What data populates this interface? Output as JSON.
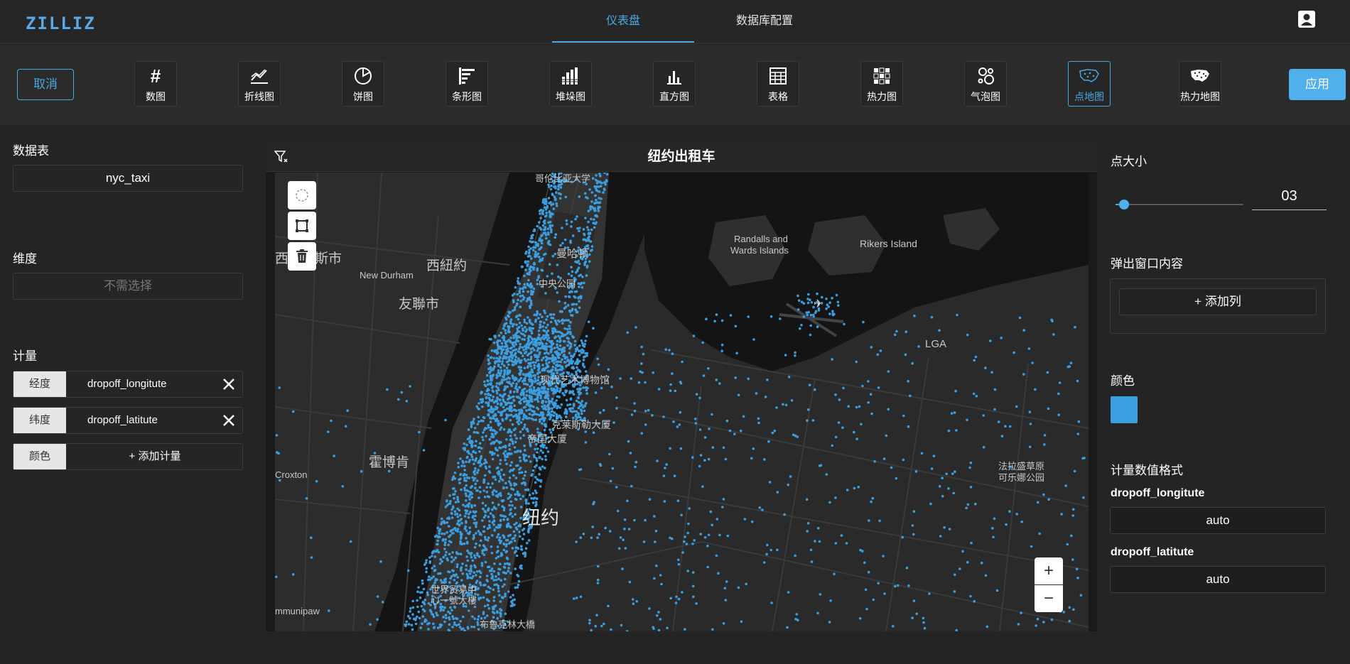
{
  "nav": {
    "logo": "ZILLIZ",
    "tabs": [
      {
        "label": "仪表盘",
        "active": true
      },
      {
        "label": "数据库配置",
        "active": false
      }
    ],
    "account_icon": "account-icon"
  },
  "toolbar": {
    "cancel_label": "取消",
    "apply_label": "应用",
    "chart_types": [
      {
        "label": "数图",
        "icon": "number-icon"
      },
      {
        "label": "折线图",
        "icon": "line-chart-icon"
      },
      {
        "label": "饼图",
        "icon": "pie-chart-icon"
      },
      {
        "label": "条形图",
        "icon": "bar-chart-icon"
      },
      {
        "label": "堆垛图",
        "icon": "stacked-chart-icon"
      },
      {
        "label": "直方图",
        "icon": "histogram-icon"
      },
      {
        "label": "表格",
        "icon": "table-icon"
      },
      {
        "label": "热力图",
        "icon": "heatmap-icon"
      },
      {
        "label": "气泡图",
        "icon": "bubble-chart-icon"
      },
      {
        "label": "点地图",
        "icon": "point-map-icon",
        "active": true
      },
      {
        "label": "热力地图",
        "icon": "heat-map-icon"
      }
    ]
  },
  "left": {
    "table_title": "数据表",
    "table_value": "nyc_taxi",
    "dimension_title": "维度",
    "dimension_placeholder": "不需选择",
    "measure_title": "计量",
    "measures": [
      {
        "tag": "经度",
        "value": "dropoff_longitute"
      },
      {
        "tag": "纬度",
        "value": "dropoff_latitute"
      },
      {
        "tag": "颜色",
        "value": "+ 添加计量"
      }
    ]
  },
  "map": {
    "title": "纽约出租车",
    "labels": [
      "哥伦比亚大学",
      "曼哈顿",
      "中央公园",
      "西紐約",
      "New Durham",
      "友聯市",
      "西",
      "斯市",
      "Randalls and",
      "Wards Islands",
      "Rikers Island",
      "LGA",
      "现代艺术博物馆",
      "克莱斯勒大厦",
      "帝国大厦",
      "霍博肯",
      "Croxton",
      "纽约",
      "世界贸易中",
      "心一號大樓",
      "mmunipaw",
      "布鲁克林大橋",
      "法拉盛草原",
      "可乐娜公园"
    ],
    "zoom_in": "+",
    "zoom_out": "−",
    "point_color": "#3a9ee0"
  },
  "right": {
    "point_size_title": "点大小",
    "point_size_value": "03",
    "point_size_fraction": 0.05,
    "popup_title": "弹出窗口内容",
    "add_column_label": "+ 添加列",
    "color_title": "颜色",
    "color_value": "#3a9ee0",
    "format_title": "计量数值格式",
    "formats": [
      {
        "name": "dropoff_longitute",
        "value": "auto"
      },
      {
        "name": "dropoff_latitute",
        "value": "auto"
      }
    ]
  }
}
